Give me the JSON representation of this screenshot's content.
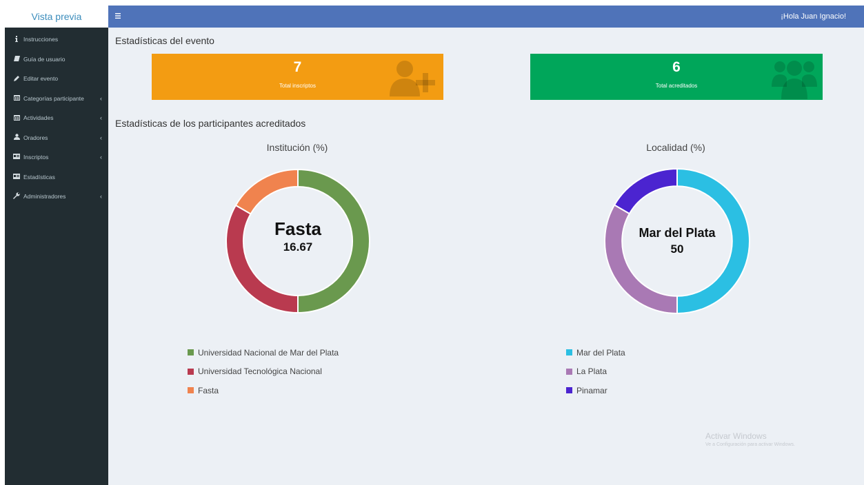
{
  "sidebar": {
    "brand": "Vista previa",
    "items": [
      {
        "label": "Instrucciones",
        "icon": "info-icon",
        "chevron": false
      },
      {
        "label": "Guía de usuario",
        "icon": "book-icon",
        "chevron": false
      },
      {
        "label": "Editar evento",
        "icon": "pencil-icon",
        "chevron": false
      },
      {
        "label": "Categorías participante",
        "icon": "calendar-icon",
        "chevron": true
      },
      {
        "label": "Actividades",
        "icon": "calendar-icon",
        "chevron": true
      },
      {
        "label": "Oradores",
        "icon": "user-icon",
        "chevron": true
      },
      {
        "label": "Inscriptos",
        "icon": "id-card-icon",
        "chevron": true
      },
      {
        "label": "Estadísticas",
        "icon": "id-card-icon",
        "chevron": false
      },
      {
        "label": "Administradores",
        "icon": "wrench-icon",
        "chevron": true
      }
    ]
  },
  "topbar": {
    "menu_icon": "hamburger-icon",
    "greeting": "¡Hola Juan Ignacio!"
  },
  "event_stats": {
    "title": "Estadísticas del evento",
    "total_inscriptos": {
      "value": "7",
      "label": "Total inscriptos",
      "color": "#f39c12",
      "icon": "user-plus-icon"
    },
    "total_acreditados": {
      "value": "6",
      "label": "Total acreditados",
      "color": "#00a65a",
      "icon": "users-icon"
    }
  },
  "accredited_stats": {
    "title": "Estadísticas de los participantes acreditados"
  },
  "chart_data": [
    {
      "type": "pie",
      "title": "Institución (%)",
      "center_label": "Fasta",
      "center_value": "16.67",
      "categories": [
        "Universidad Nacional de Mar del Plata",
        "Universidad Tecnológica Nacional",
        "Fasta"
      ],
      "values": [
        50,
        33.33,
        16.67
      ],
      "colors": [
        "#6a994e",
        "#b93a4f",
        "#f0834e"
      ]
    },
    {
      "type": "pie",
      "title": "Localidad (%)",
      "center_label": "Mar del Plata",
      "center_value": "50",
      "categories": [
        "Mar del Plata",
        "La Plata",
        "Pinamar"
      ],
      "values": [
        50,
        33.33,
        16.67
      ],
      "colors": [
        "#2bbfe3",
        "#a979b4",
        "#4b24d0"
      ]
    }
  ],
  "watermark": {
    "line1": "Activar Windows",
    "line2": "Ve a Configuración para activar Windows."
  }
}
